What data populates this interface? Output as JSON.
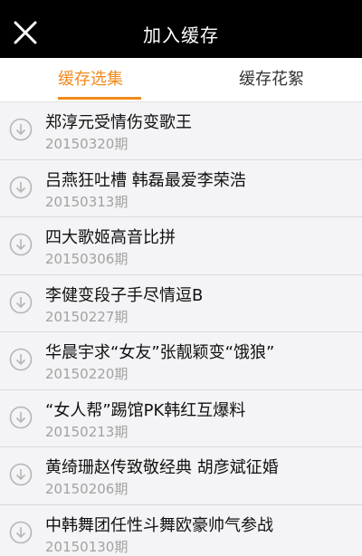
{
  "header": {
    "title": "加入缓存",
    "close_icon": "close-icon"
  },
  "tabs": [
    {
      "label": "缓存选集",
      "active": true
    },
    {
      "label": "缓存花絮",
      "active": false
    }
  ],
  "colors": {
    "accent": "#f08a1c",
    "header_bg": "#000000",
    "list_bg": "#f4f4f6",
    "date_text": "#a2a2a2"
  },
  "episodes": [
    {
      "title": "郑淳元受情伤变歌王",
      "date": "20150320期"
    },
    {
      "title": "吕燕狂吐槽 韩磊最爱李荣浩",
      "date": "20150313期"
    },
    {
      "title": "四大歌姬高音比拼",
      "date": "20150306期"
    },
    {
      "title": "李健变段子手尽情逗B",
      "date": "20150227期"
    },
    {
      "title": "华晨宇求“女友”张靓颖变“饿狼”",
      "date": "20150220期"
    },
    {
      "title": "“女人帮”踢馆PK韩红互爆料",
      "date": "20150213期"
    },
    {
      "title": "黄绮珊赵传致敬经典 胡彦斌征婚",
      "date": "20150206期"
    },
    {
      "title": "中韩舞团任性斗舞欧豪帅气参战",
      "date": "20150130期"
    }
  ]
}
